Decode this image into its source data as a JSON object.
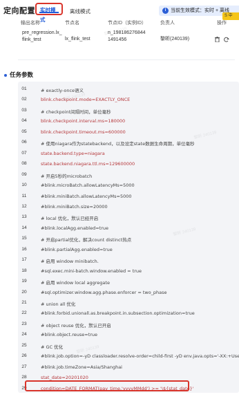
{
  "header": {
    "title": "定向配置",
    "tabs": [
      {
        "label": "实时模式",
        "active": true
      },
      {
        "label": "离线模式",
        "active": false
      }
    ],
    "notice_text": "当前生效模式：实时 + 离线",
    "extension_badge": "S 中"
  },
  "output_table": {
    "columns": [
      "输出名称",
      "节点名",
      "节点ID（实例ID）",
      "负责人",
      "操作"
    ],
    "rows": [
      {
        "output_name": "pre_regression.lx_flink_test",
        "node_name": "lx_flink_test",
        "node_id": "n_198186276844 1491456",
        "owner": "黎昕(240139)"
      }
    ]
  },
  "task_params": {
    "title": "任务参数",
    "lines": [
      {
        "n": "01",
        "text": "# exactly-once语义",
        "kind": "comment"
      },
      {
        "n": "02",
        "text": "blink.checkpoint.mode=EXACTLY_ONCE",
        "kind": "config"
      },
      {
        "n": "03",
        "text": "# checkpoint间隔时间，单位毫秒",
        "kind": "comment"
      },
      {
        "n": "04",
        "text": "blink.checkpoint.interval.ms=180000",
        "kind": "config"
      },
      {
        "n": "05",
        "text": "blink.checkpoint.timeout.ms=600000",
        "kind": "config"
      },
      {
        "n": "06",
        "text": "# 使用niagara作为statebackend，以及设定state数据生命周期，单位毫秒",
        "kind": "comment"
      },
      {
        "n": "07",
        "text": "state.backend.type=niagara",
        "kind": "config"
      },
      {
        "n": "08",
        "text": "state.backend.niagara.ttl.ms=129600000",
        "kind": "config"
      },
      {
        "n": "09",
        "text": "# 开启5秒的microbatch",
        "kind": "comment"
      },
      {
        "n": "10",
        "text": "#blink.microBatch.allowLatencyMs=5000",
        "kind": "comment"
      },
      {
        "n": "11",
        "text": "#blink.miniBatch.allowLatencyMs=5000",
        "kind": "comment"
      },
      {
        "n": "12",
        "text": "#blink.miniBatch.size=20000",
        "kind": "comment"
      },
      {
        "n": "13",
        "text": "# local 优化，默认已经开启",
        "kind": "comment"
      },
      {
        "n": "14",
        "text": "#blink.localAgg.enabled=true",
        "kind": "comment"
      },
      {
        "n": "15",
        "text": "# 开启partial优化，解决count distinct热点",
        "kind": "comment"
      },
      {
        "n": "16",
        "text": "#blink.partialAgg.enabled=true",
        "kind": "comment"
      },
      {
        "n": "17",
        "text": "# 启用 window minibatch.",
        "kind": "comment"
      },
      {
        "n": "18",
        "text": "#sql.exec.mini-batch.window.enabled = true",
        "kind": "comment"
      },
      {
        "n": "19",
        "text": "# 启用 window local aggregate",
        "kind": "comment"
      },
      {
        "n": "20",
        "text": "#sql.optimizer.window.agg.phase.enforcer = two_phase",
        "kind": "comment"
      },
      {
        "n": "21",
        "text": "# union all 优化",
        "kind": "comment"
      },
      {
        "n": "22",
        "text": "#blink.forbid.unionall.as.breakpoint.in.subsection.optimization=true",
        "kind": "comment"
      },
      {
        "n": "23",
        "text": "# object reuse 优化，默认已开启",
        "kind": "comment"
      },
      {
        "n": "24",
        "text": "#blink.object.reuse=true",
        "kind": "comment"
      },
      {
        "n": "25",
        "text": "# GC 优化",
        "kind": "comment"
      },
      {
        "n": "26",
        "text": "#blink.job.option=-yD classloader.resolve-order=child-first -yD env.java.opts='-XX:+UseParNew",
        "kind": "comment"
      },
      {
        "n": "27",
        "text": "#blink.job.timeZone=Asia/Shanghai",
        "kind": "comment"
      },
      {
        "n": "28",
        "text": "stat_date=20201020",
        "kind": "config"
      },
      {
        "n": "29",
        "text": "condition=DATE_FORMAT(pay_time,'yyyyMMdd') >= '\\${stat_date}'",
        "kind": "config"
      }
    ]
  },
  "colors": {
    "accent": "#1f5bd8",
    "highlight_border": "#d9342b",
    "config_text": "#b5373a",
    "code_bg": "#f3f4f7"
  }
}
